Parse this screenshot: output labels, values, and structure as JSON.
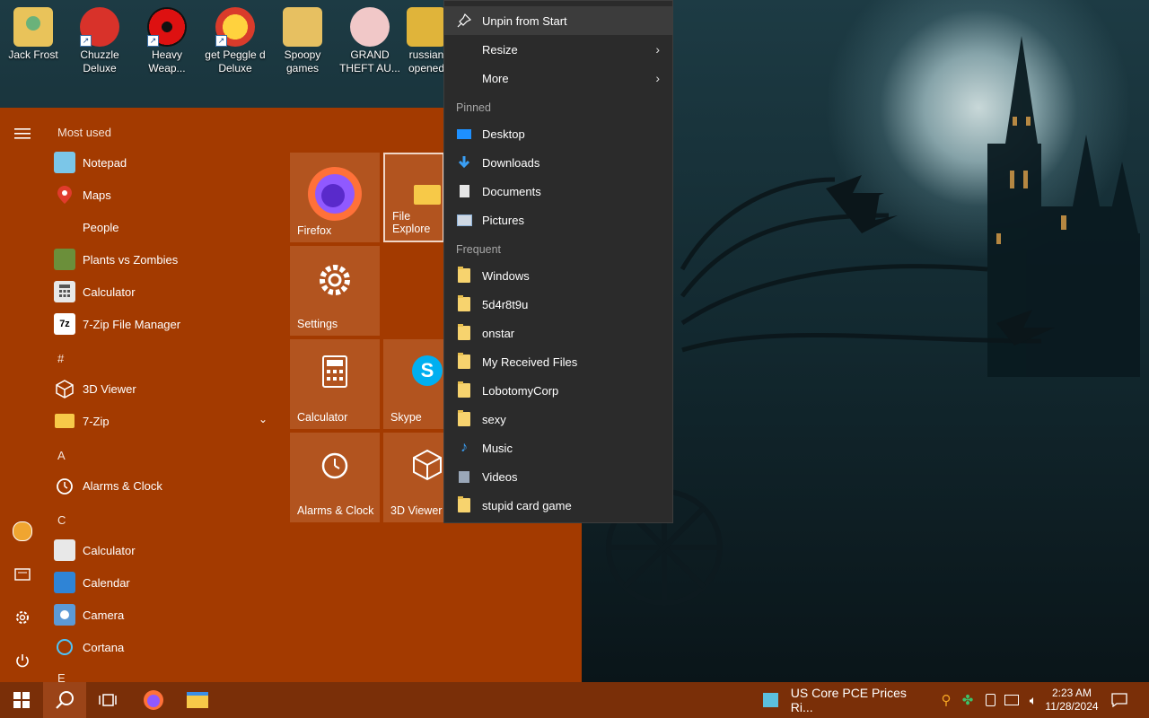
{
  "desktop": {
    "icons": [
      {
        "label1": "Jack Frost",
        "label2": ""
      },
      {
        "label1": "Chuzzle",
        "label2": "Deluxe"
      },
      {
        "label1": "Heavy",
        "label2": "Weap..."
      },
      {
        "label1": "get Peggle d",
        "label2": "Deluxe"
      },
      {
        "label1": "Spoopy",
        "label2": "games"
      },
      {
        "label1": "GRAND",
        "label2": "THEFT AU..."
      },
      {
        "label1": "russian",
        "label2": "opened"
      }
    ]
  },
  "start_menu": {
    "section_most_used": "Most used",
    "most_used": [
      "Notepad",
      "Maps",
      "People",
      "Plants vs Zombies",
      "Calculator",
      "7-Zip File Manager"
    ],
    "section_hash": "#",
    "hash_items": [
      "3D Viewer",
      "7-Zip"
    ],
    "section_a": "A",
    "a_items": [
      "Alarms & Clock"
    ],
    "section_c": "C",
    "c_items": [
      "Calculator",
      "Calendar",
      "Camera",
      "Cortana"
    ],
    "section_e": "E",
    "tiles": [
      {
        "label": "Firefox"
      },
      {
        "label": "File Explore"
      },
      {
        "label": "Settings"
      },
      {
        "label": "Calculator"
      },
      {
        "label": "Skype"
      },
      {
        "label": "Alarms & Clock"
      },
      {
        "label": "3D Viewer"
      }
    ]
  },
  "context_menu": {
    "unpin": "Unpin from Start",
    "resize": "Resize",
    "more": "More",
    "pinned_header": "Pinned",
    "pinned": [
      "Desktop",
      "Downloads",
      "Documents",
      "Pictures"
    ],
    "frequent_header": "Frequent",
    "frequent": [
      "Windows",
      "5d4r8t9u",
      "onstar",
      "My Received Files",
      "LobotomyCorp",
      "sexy",
      "Music",
      "Videos",
      "stupid card game"
    ]
  },
  "taskbar": {
    "news_text": "US Core PCE Prices Ri...",
    "time": "2:23 AM",
    "date": "11/28/2024"
  },
  "colors": {
    "start_bg": "#a33a00",
    "tile_bg": "#b2541f",
    "taskbar_bg": "#7a2f08",
    "menu_bg": "#2b2b2b"
  }
}
